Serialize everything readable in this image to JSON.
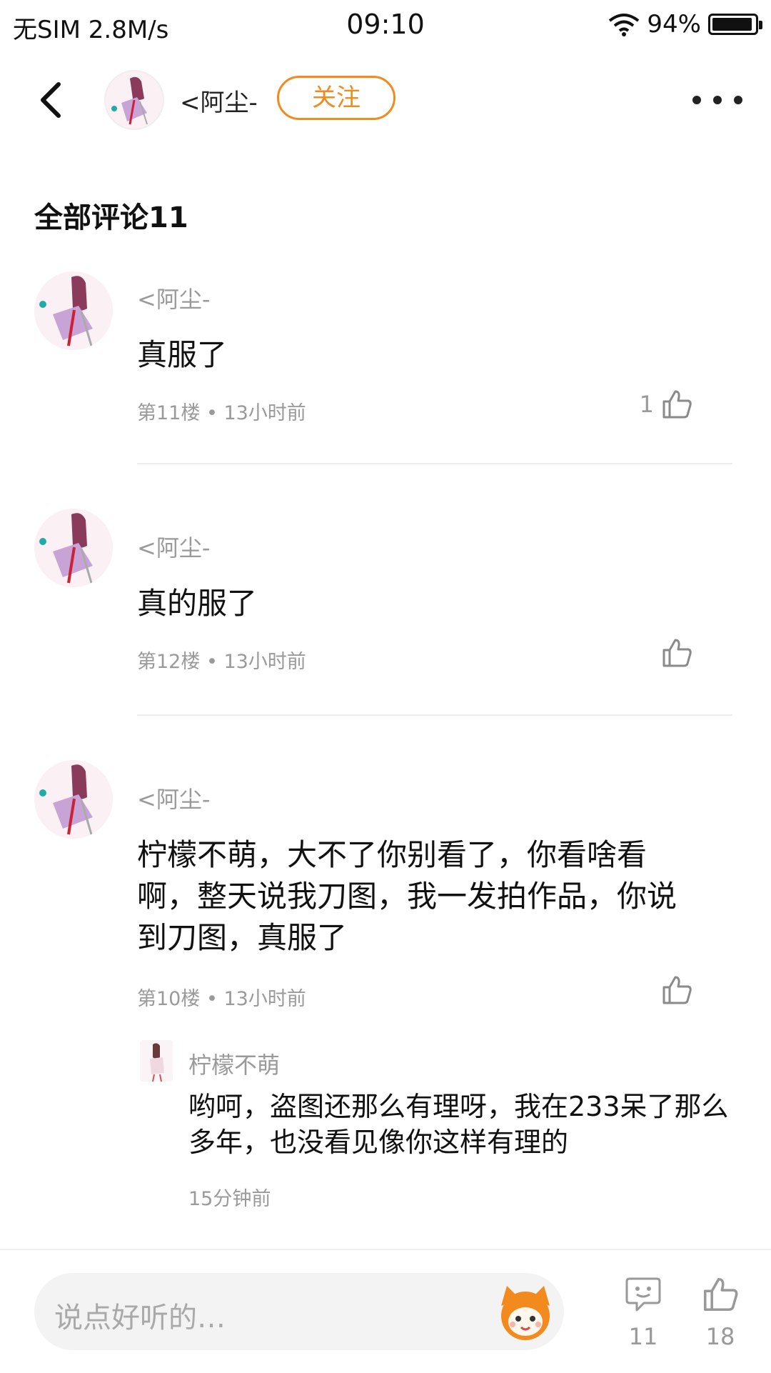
{
  "status_bar": {
    "carrier": "无SIM",
    "speed": "2.8M/s",
    "time": "09:10",
    "battery": "94%",
    "battery_level": 0.94
  },
  "header": {
    "name": "<阿尘-",
    "follow_label": "关注"
  },
  "section": {
    "title": "全部评论11"
  },
  "comments": [
    {
      "name": "<阿尘-",
      "text": "真服了",
      "meta": "第11楼 • 13小时前",
      "likes": "1"
    },
    {
      "name": "<阿尘-",
      "text": "真的服了",
      "meta": "第12楼 • 13小时前",
      "likes": ""
    },
    {
      "name": "<阿尘-",
      "text": "柠檬不萌，大不了你别看了，你看啥看啊，整天说我刀图，我一发拍作品，你说到刀图，真服了",
      "meta": "第10楼 • 13小时前",
      "likes": "",
      "reply": {
        "name": "柠檬不萌",
        "text": "哟呵，盗图还那么有理呀，我在233呆了那么多年，也没看见像你这样有理的",
        "meta": "15分钟前"
      }
    }
  ],
  "bottom_bar": {
    "placeholder": "说点好听的…",
    "comment_count": "11",
    "like_count": "18"
  },
  "colors": {
    "accent": "#f28a1e",
    "muted": "#9a9a9a"
  }
}
